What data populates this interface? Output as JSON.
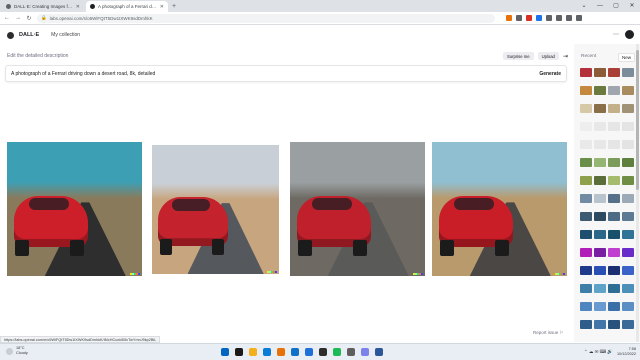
{
  "browser": {
    "tabs": [
      {
        "title": "DALL·E: Creating Images from Te",
        "favicon_color": "#5f6368",
        "active": false
      },
      {
        "title": "A photograph of a Ferrari drivin",
        "favicon_color": "#202124",
        "active": true
      }
    ],
    "new_tab": "+",
    "window_controls": [
      "⌄",
      "—",
      "▢",
      "✕"
    ],
    "url": "labs.openai.com/s/o5WiFQtT5Dw1tXWK9sdDmhkK",
    "extension_colors": [
      "#e8710a",
      "#5f6368",
      "#d93025",
      "#1a73e8",
      "#5f6368",
      "#5f6368",
      "#5f6368",
      "#5f6368"
    ]
  },
  "app": {
    "brand": "DALL·E",
    "nav_collection": "My collection",
    "menu_icon": "⋯"
  },
  "editor": {
    "label": "Edit the detailed description",
    "surprise_label": "Surprise me",
    "upload_label": "Upload",
    "collapse_icon": "⇥",
    "prompt": "A photograph of a Ferrari driving down a desert road, 8k, detailed",
    "generate_label": "Generate"
  },
  "results": [
    {
      "alt": "red-ferrari-desert-road-rear-left",
      "sky": "#3d9fb4",
      "ground": "#8a7a5c",
      "road": "#2e2e2e",
      "car": "#cc1f2a"
    },
    {
      "alt": "red-ferrari-desert-hills-rear",
      "sky": "#c9cfd6",
      "ground": "#c7a57f",
      "road": "#55585c",
      "car": "#c4222d"
    },
    {
      "alt": "red-ferrari-mountain-road-rear",
      "sky": "#9aa0a2",
      "ground": "#6e6a63",
      "road": "#5a5a58",
      "car": "#c0202b"
    },
    {
      "alt": "red-ferrari-motion-blur-road",
      "sky": "#8fbfd1",
      "ground": "#b99a6d",
      "road": "#4a4745",
      "car": "#c91e28"
    }
  ],
  "report_label": "Report issue ⚐",
  "sidebar": {
    "header": "Recent",
    "new_label": "New",
    "thumb_colors": [
      "#b2313a",
      "#8c5b3a",
      "#a94038",
      "#7b8d9a",
      "#c4893c",
      "#6b7a3e",
      "#9fa6ad",
      "#a88b5e",
      "#d6c9a8",
      "#8a6e48",
      "#c3b08a",
      "#a09274",
      "#eeeeee",
      "#e8e8e8",
      "#e6e6e6",
      "#e4e4e4",
      "#e9e9e9",
      "#e7e7e7",
      "#e5e5e5",
      "#e3e3e3",
      "#6b8f4a",
      "#95b573",
      "#7c9c5a",
      "#5e7f3d",
      "#8fa04d",
      "#5a6e3a",
      "#a6bb6c",
      "#6f8d45",
      "#7189a2",
      "#b7c3cd",
      "#56708a",
      "#9caab8",
      "#3d5a73",
      "#2e4a60",
      "#4e6b85",
      "#5d7a95",
      "#1f4f6e",
      "#2b6789",
      "#19506b",
      "#2f7396",
      "#b01fb8",
      "#7a1fa1",
      "#c03fd0",
      "#6a2cc9",
      "#1f3a8a",
      "#2a4fb5",
      "#1c2f70",
      "#3a62c7",
      "#3d7fa9",
      "#5fa3c8",
      "#2e6e94",
      "#4c8fb8",
      "#4e86c0",
      "#6a9bd0",
      "#3a6fa8",
      "#5a8ec5",
      "#2f5d8a",
      "#4275a8",
      "#26527c",
      "#3a6a9a"
    ]
  },
  "status_url": "https://labs.openai.com/e/o5WiFQtT5Dw1tXWK9sdDmhkK/IMcHCuxk5l5xTwYmnJ9kp2BiL",
  "taskbar": {
    "temp": "18°C",
    "condition": "Cloudy",
    "app_colors": [
      "#0067c0",
      "#1a1a1a",
      "#f2b01e",
      "#0a7cd6",
      "#e8710a",
      "#0f6fc9",
      "#1e6fd9",
      "#2d2d2d",
      "#1db954",
      "#5e5e5e",
      "#7b83eb",
      "#2b579a"
    ],
    "tray_symbols": "⌃  ☁  ✉  ⌨  🔊",
    "time": "7:58",
    "date": "10/12/2022"
  }
}
